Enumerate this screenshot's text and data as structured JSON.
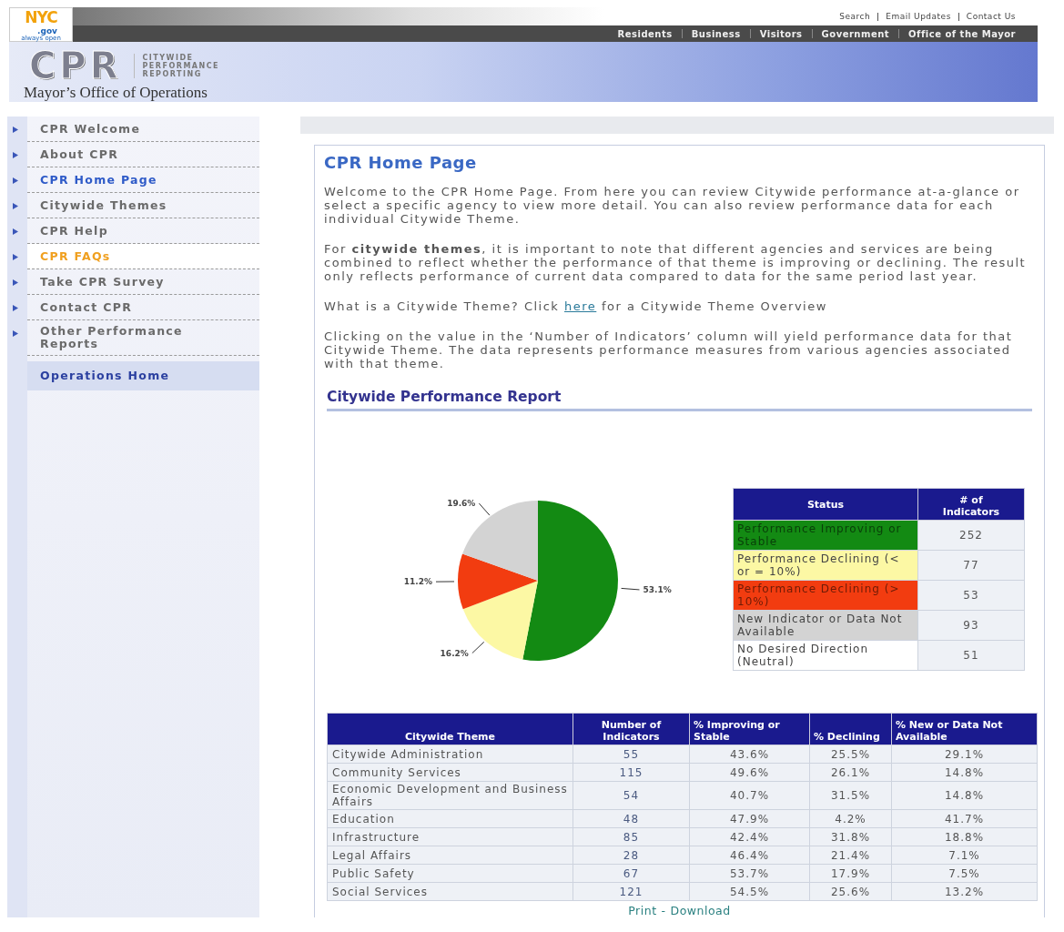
{
  "header": {
    "logo": {
      "main": "NYC",
      "domain": ".gov",
      "tagline": "always open"
    },
    "utility_links": [
      "Search",
      "Email Updates",
      "Contact Us"
    ],
    "nav": [
      "Residents",
      "Business",
      "Visitors",
      "Government",
      "Office of the Mayor"
    ],
    "banner": {
      "mark": "CPR",
      "subtitle_lines": [
        "CITYWIDE",
        "PERFORMANCE",
        "REPORTING"
      ],
      "office": "Mayor’s Office of Operations"
    }
  },
  "sidebar": {
    "items": [
      {
        "label": "CPR Welcome",
        "kind": "page",
        "selected": false,
        "highlighted": false
      },
      {
        "label": "About CPR",
        "kind": "page",
        "selected": false,
        "highlighted": false
      },
      {
        "label": "CPR Home Page",
        "kind": "page",
        "selected": true,
        "highlighted": false
      },
      {
        "label": "Citywide Themes",
        "kind": "page",
        "selected": false,
        "highlighted": false
      },
      {
        "label": "CPR Help",
        "kind": "page",
        "selected": false,
        "highlighted": false
      },
      {
        "label": "CPR FAQs",
        "kind": "page",
        "selected": false,
        "highlighted": true
      },
      {
        "label": "Take CPR Survey",
        "kind": "page",
        "selected": false,
        "highlighted": false
      },
      {
        "label": "Contact CPR",
        "kind": "page",
        "selected": false,
        "highlighted": false
      },
      {
        "label": "Other Performance Reports",
        "kind": "page",
        "selected": false,
        "highlighted": false
      },
      {
        "label": "Operations Home",
        "kind": "home",
        "selected": false,
        "highlighted": false
      }
    ]
  },
  "content": {
    "title": "CPR Home Page",
    "paragraphs": [
      {
        "text": "Welcome to the CPR Home Page. From here you can review Citywide performance at-a-glance or select a specific agency to view more detail. You can also review performance data for each individual Citywide Theme."
      },
      {
        "text": "For **citywide themes**, it is important to note that different agencies and services are being combined to reflect whether the performance of that theme is improving or declining. The result only reflects performance of current data compared to data for the same period last year."
      },
      {
        "text": "What is a Citywide Theme? Click",
        "link": "here",
        "after": "for a Citywide Theme Overview"
      },
      {
        "text": "Clicking on the value in the ‘Number of Indicators’ column will yield performance data for that Citywide Theme. The data represents performance measures from various agencies associated with that theme."
      }
    ],
    "report_heading": "Citywide Performance Report",
    "chart_data": {
      "type": "pie",
      "values": [
        53.1,
        16.2,
        11.2,
        19.6
      ],
      "value_labels": [
        "53.1%",
        "16.2%",
        "11.2%",
        "19.6%"
      ]
    },
    "status_table": {
      "columns": [
        "Status",
        "# of Indicators"
      ],
      "rows": [
        {
          "status": "Performance Improving or Stable",
          "count": "252",
          "color": "#138a13"
        },
        {
          "status": "Performance Declining (< or = 10%)",
          "count": "77",
          "color": "#fcf8a4"
        },
        {
          "status": "Performance Declining (> 10%)",
          "count": "53",
          "color": "#f23c10"
        },
        {
          "status": "New Indicator or Data Not Available",
          "count": "93",
          "color": "#d3d3d3"
        },
        {
          "status": "No Desired Direction (Neutral)",
          "count": "51",
          "color": "#ffffff"
        }
      ]
    },
    "theme_table": {
      "columns": [
        "Citywide Theme",
        "Number of Indicators",
        "% Improving or Stable",
        "% Declining",
        "% New or Data Not Available"
      ],
      "rows": [
        [
          "Citywide Administration",
          "55",
          "43.6%",
          "25.5%",
          "29.1%"
        ],
        [
          "Community Services",
          "115",
          "49.6%",
          "26.1%",
          "14.8%"
        ],
        [
          "Economic Development and Business Affairs",
          "54",
          "40.7%",
          "31.5%",
          "14.8%"
        ],
        [
          "Education",
          "48",
          "47.9%",
          "4.2%",
          "41.7%"
        ],
        [
          "Infrastructure",
          "85",
          "42.4%",
          "31.8%",
          "18.8%"
        ],
        [
          "Legal Affairs",
          "28",
          "46.4%",
          "21.4%",
          "7.1%"
        ],
        [
          "Public Safety",
          "67",
          "53.7%",
          "17.9%",
          "7.5%"
        ],
        [
          "Social Services",
          "121",
          "54.5%",
          "25.6%",
          "13.2%"
        ]
      ]
    },
    "footer_links": {
      "items": [
        "Print",
        "Download"
      ],
      "separator": "-"
    }
  }
}
